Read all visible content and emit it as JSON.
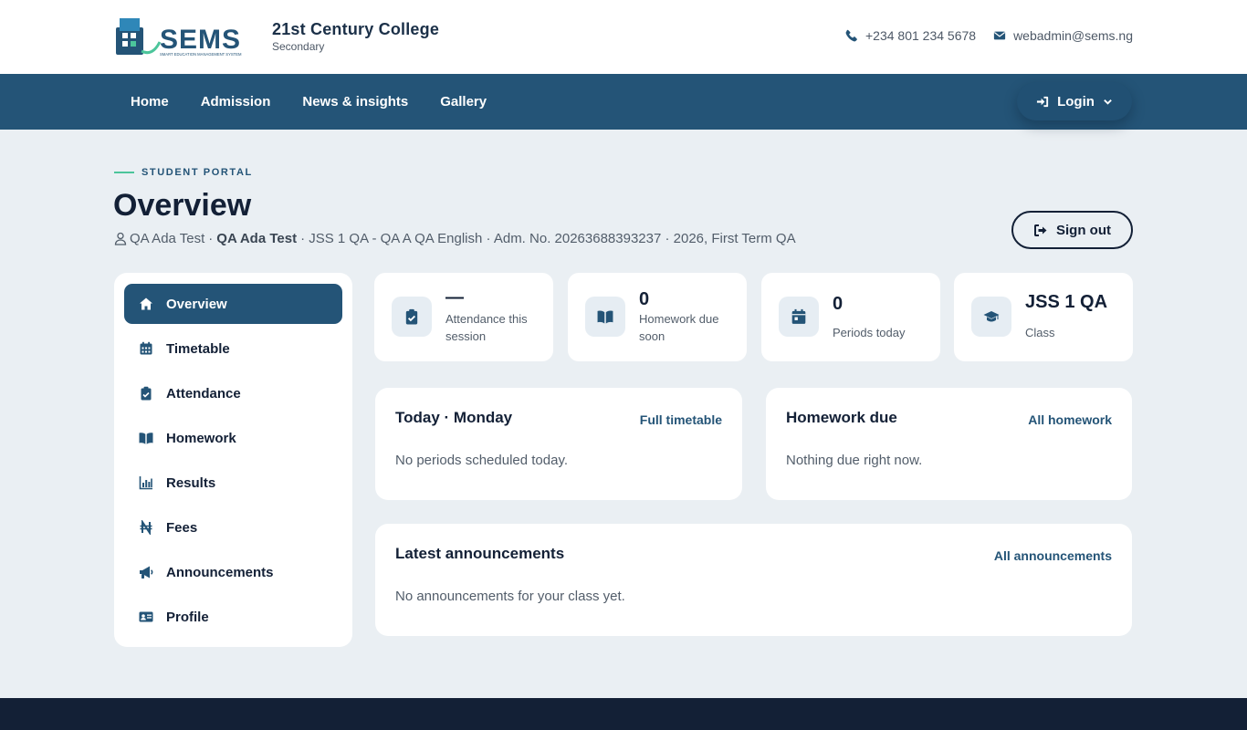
{
  "header": {
    "college_name": "21st Century College",
    "college_sub": "Secondary",
    "logo_text": "SEMS",
    "logo_tagline": "SMART EDUCATION MANAGEMENT SYSTEM",
    "phone": "+234 801 234 5678",
    "email": "webadmin@sems.ng"
  },
  "nav": {
    "links": [
      "Home",
      "Admission",
      "News & insights",
      "Gallery"
    ],
    "login_label": "Login"
  },
  "page": {
    "eyebrow": "STUDENT PORTAL",
    "title": "Overview",
    "student_name": "QA Ada Test",
    "student_name_bold": "QA Ada Test",
    "details": "· JSS 1 QA - QA A QA English · Adm. No. 20263688393237 · 2026, First Term QA",
    "sep": "·",
    "signout_label": "Sign out"
  },
  "sidebar": {
    "items": [
      "Overview",
      "Timetable",
      "Attendance",
      "Homework",
      "Results",
      "Fees",
      "Announcements",
      "Profile"
    ],
    "active": "Overview"
  },
  "stats": [
    {
      "value": "—",
      "label": "Attendance this session",
      "icon": "clipboard-check-icon"
    },
    {
      "value": "0",
      "label": "Homework due soon",
      "icon": "book-open-icon"
    },
    {
      "value": "0",
      "label": "Periods today",
      "icon": "calendar-icon"
    },
    {
      "value": "JSS 1 QA",
      "label": "Class",
      "icon": "graduation-cap-icon"
    }
  ],
  "panels": {
    "today": {
      "title": "Today · Monday",
      "link": "Full timetable",
      "empty": "No periods scheduled today."
    },
    "homework": {
      "title": "Homework due",
      "link": "All homework",
      "empty": "Nothing due right now."
    },
    "announcements": {
      "title": "Latest announcements",
      "link": "All announcements",
      "empty": "No announcements for your class yet."
    }
  },
  "colors": {
    "primary": "#245477",
    "dark": "#132036",
    "accent": "#4cc59b",
    "background": "#eaeff3"
  }
}
